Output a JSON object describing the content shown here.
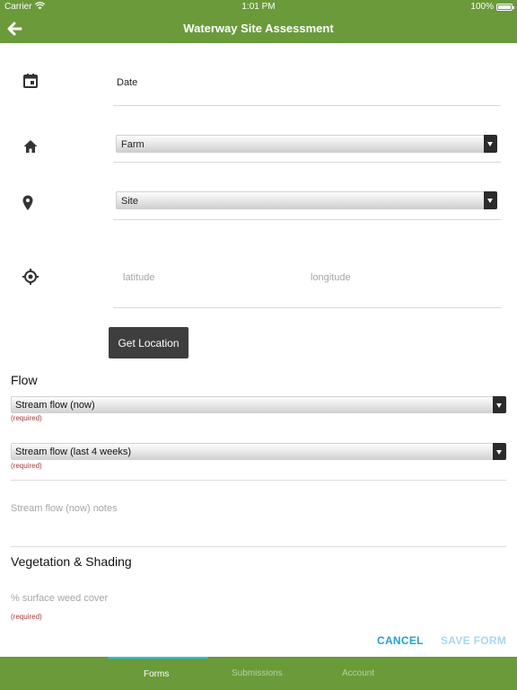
{
  "status_bar": {
    "carrier": "Carrier",
    "time": "1:01 PM",
    "battery": "100%"
  },
  "header": {
    "title": "Waterway Site Assessment",
    "back_icon": "arrow-left-icon"
  },
  "form": {
    "date": {
      "icon": "calendar-icon",
      "label": "Date"
    },
    "farm": {
      "icon": "home-icon",
      "selected": "Farm"
    },
    "site": {
      "icon": "map-pin-icon",
      "selected": "Site"
    },
    "location": {
      "icon": "crosshair-icon",
      "latitude_placeholder": "latitude",
      "longitude_placeholder": "longitude",
      "get_location_label": "Get Location"
    },
    "flow": {
      "title": "Flow",
      "stream_flow_now": {
        "selected": "Stream flow (now)",
        "required": "(required)"
      },
      "stream_flow_last4": {
        "selected": "Stream flow (last 4 weeks)",
        "required": "(required)"
      },
      "notes_placeholder": "Stream flow (now) notes"
    },
    "vegetation": {
      "title": "Vegetation & Shading",
      "weed_cover_placeholder": "% surface weed cover",
      "required": "(required)"
    }
  },
  "actions": {
    "cancel": "CANCEL",
    "save": "SAVE FORM"
  },
  "tabs": [
    {
      "label": "Forms",
      "active": true
    },
    {
      "label": "Submissions",
      "active": false
    },
    {
      "label": "Account",
      "active": false
    }
  ],
  "colors": {
    "brand_green": "#6a9a3a",
    "accent_blue": "#1fa0d8",
    "required_red": "#a33a3a",
    "tab_indicator": "#21c3ea"
  }
}
